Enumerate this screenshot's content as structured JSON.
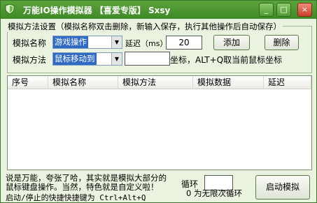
{
  "window": {
    "title": "万能IO操作模拟器 【喜爱专版】 Sxsy",
    "icon": "shield-icon",
    "accent_color": "#4c9630"
  },
  "title_buttons": {
    "minimize": "_",
    "restore": "□",
    "close": "×"
  },
  "settings": {
    "group_title": "模拟方法设置（模拟名称双击删除，新输入保存，执行其他操作后自动保存）",
    "name_label": "模拟名称",
    "name_value": "游戏操作",
    "delay_label": "延迟（ms）",
    "delay_value": "20",
    "add_button": "添加",
    "delete_button": "删除",
    "method_label": "模拟方法",
    "method_value": "鼠标移动到",
    "coord_value": "",
    "coord_hint": "坐标，ALT+Q取当前鼠标坐标"
  },
  "table": {
    "columns": [
      "序号",
      "模拟名称",
      "模拟方法",
      "模拟数据",
      "延迟"
    ],
    "rows": []
  },
  "footer": {
    "info_line1": "说是万能，夸张了哈，其实就是模拟大部分的",
    "info_line2": "鼠标键盘操作。当然，特色就是自定义啦！",
    "hotkey_text": "启动/停止的快捷快捷键为 Ctrl+Alt+Q",
    "loop_label": "循环",
    "loop_value": "",
    "loop_note": "0 为无限次循环",
    "start_button": "启动模拟"
  }
}
